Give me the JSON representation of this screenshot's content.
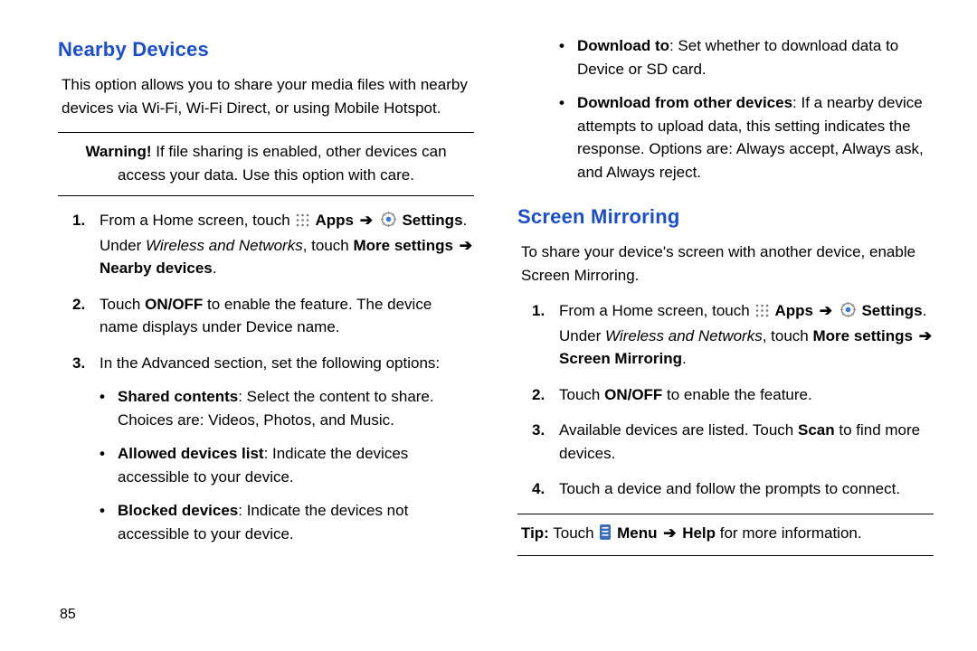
{
  "page_number": "85",
  "arrow_glyph": "➔",
  "icons": {
    "apps": "apps-icon",
    "settings": "settings-icon",
    "menu": "menu-icon"
  },
  "left": {
    "heading": "Nearby Devices",
    "intro": "This option allows you to share your media files with nearby devices via Wi-Fi, Wi-Fi Direct, or using Mobile Hotspot.",
    "warning_label": "Warning!",
    "warning_text": " If file sharing is enabled, other devices can access your data. Use this option with care.",
    "step1_a": "From a Home screen, touch ",
    "step1_apps": " Apps",
    "step1_settings": " Settings",
    "step1_b": ". Under ",
    "step1_wn": "Wireless and Networks",
    "step1_c": ", touch ",
    "step1_more": "More settings",
    "step1_d": " ",
    "step1_nearby": "Nearby devices",
    "step1_e": ".",
    "step2_a": "Touch ",
    "step2_onoff": "ON/OFF",
    "step2_b": " to enable the feature. The device name displays under Device name.",
    "step3": "In the Advanced section, set the following options:",
    "b1_t": "Shared contents",
    "b1_r": ": Select the content to share. Choices are: Videos, Photos, and Music.",
    "b2_t": "Allowed devices list",
    "b2_r": ": Indicate the devices accessible to your device.",
    "b3_t": "Blocked devices",
    "b3_r": ": Indicate the devices not accessible to your device."
  },
  "right": {
    "b4_t": "Download to",
    "b4_r": ": Set whether to download data to Device or SD card.",
    "b5_t": "Download from other devices",
    "b5_r": ": If a nearby device attempts to upload data, this setting indicates the response. Options are: Always accept, Always ask, and Always reject.",
    "heading": "Screen Mirroring",
    "intro": "To share your device's screen with another device, enable Screen Mirroring.",
    "step1_a": "From a Home screen, touch ",
    "step1_apps": " Apps",
    "step1_settings": " Settings",
    "step1_b": ". Under ",
    "step1_wn": "Wireless and Networks",
    "step1_c": ", touch ",
    "step1_more": "More settings",
    "step1_d": " ",
    "step1_sm": "Screen Mirroring",
    "step1_e": ".",
    "step2_a": "Touch ",
    "step2_onoff": "ON/OFF",
    "step2_b": " to enable the feature.",
    "step3_a": "Available devices are listed. Touch ",
    "step3_scan": "Scan",
    "step3_b": " to find more devices.",
    "step4": "Touch a device and follow the prompts to connect.",
    "tip_label": "Tip:",
    "tip_a": " Touch ",
    "tip_menu": " Menu",
    "tip_help": " Help",
    "tip_b": " for more information."
  }
}
